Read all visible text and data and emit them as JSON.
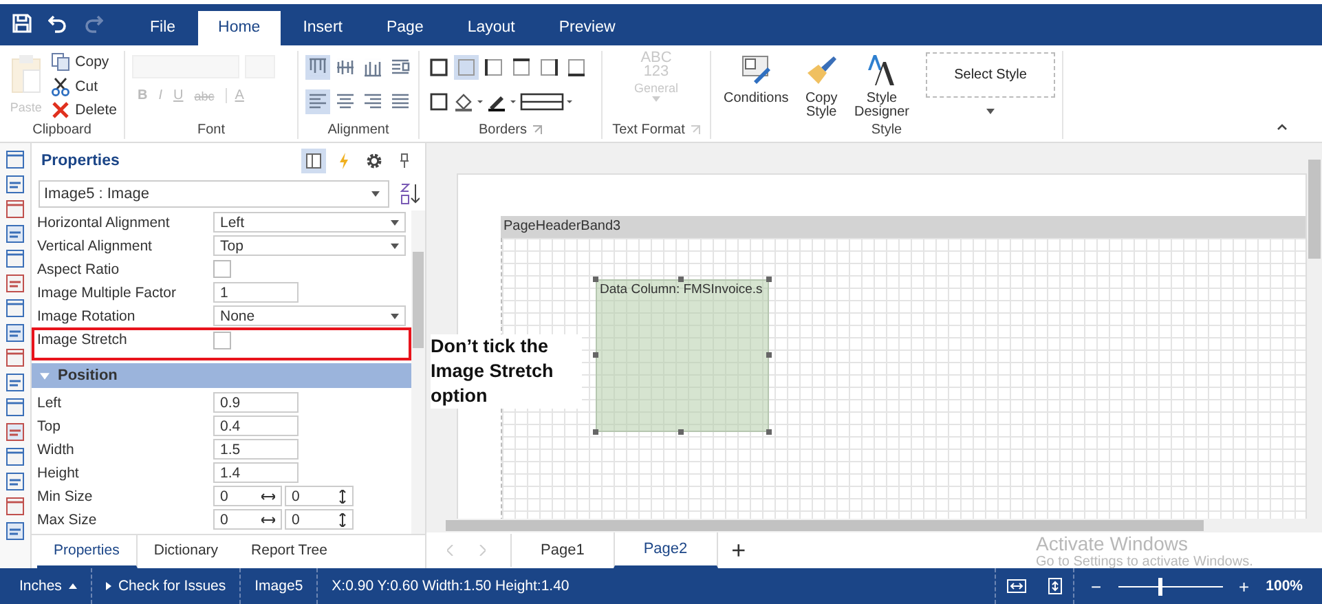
{
  "toolbar": [
    {
      "kind": "save",
      "disabled": false
    },
    {
      "kind": "undo",
      "disabled": false
    },
    {
      "kind": "redo",
      "disabled": true
    }
  ],
  "menu_tabs": [
    {
      "label": "File",
      "selected": false
    },
    {
      "label": "Home",
      "selected": true
    },
    {
      "label": "Insert",
      "selected": false
    },
    {
      "label": "Page",
      "selected": false
    },
    {
      "label": "Layout",
      "selected": false
    },
    {
      "label": "Preview",
      "selected": false
    }
  ],
  "clipboard": {
    "label": "Clipboard",
    "paste": {
      "label": "Paste",
      "disabled": true
    },
    "items": [
      {
        "kind": "copy",
        "label": "Copy"
      },
      {
        "kind": "cut",
        "label": "Cut"
      },
      {
        "kind": "delete",
        "label": "Delete"
      }
    ]
  },
  "font": {
    "label": "Font",
    "disabled": true,
    "styles": [
      "B",
      "I",
      "U",
      "abc",
      "A"
    ]
  },
  "alignment": {
    "label": "Alignment",
    "rows": [
      [
        {
          "kind": "top",
          "selected": true
        },
        {
          "kind": "middle",
          "selected": false
        },
        {
          "kind": "bottom",
          "selected": false
        },
        {
          "kind": "wrap",
          "selected": false
        }
      ],
      [
        {
          "kind": "left",
          "selected": true
        },
        {
          "kind": "center",
          "selected": false
        },
        {
          "kind": "right",
          "selected": false
        },
        {
          "kind": "justify",
          "selected": false
        }
      ]
    ]
  },
  "borders": {
    "label": "Borders",
    "sides": [
      {
        "kind": "all",
        "selected": false
      },
      {
        "kind": "none",
        "selected": true
      },
      {
        "kind": "left",
        "selected": false
      },
      {
        "kind": "top",
        "selected": false
      },
      {
        "kind": "right",
        "selected": false
      },
      {
        "kind": "bottom",
        "selected": false
      }
    ],
    "tools": [
      {
        "kind": "outline"
      },
      {
        "kind": "fill"
      },
      {
        "kind": "pen"
      },
      {
        "kind": "line-style"
      }
    ]
  },
  "text_format": {
    "label": "Text Format",
    "disabled": true,
    "sample": [
      "ABC",
      "123"
    ],
    "format": "General"
  },
  "style": {
    "label": "Style",
    "buttons": [
      {
        "kind": "conditions",
        "label": "Conditions"
      },
      {
        "kind": "copy-style",
        "label": "Copy Style"
      },
      {
        "kind": "designer",
        "label": "Style Designer"
      }
    ],
    "select_style": "Select Style"
  },
  "properties": {
    "title": "Properties",
    "tools": [
      {
        "kind": "grid",
        "selected": true
      },
      {
        "kind": "events",
        "selected": false
      },
      {
        "kind": "settings",
        "selected": false
      },
      {
        "kind": "pin",
        "selected": false
      }
    ],
    "component": "Image5 : Image",
    "rows": [
      {
        "kind": "select",
        "label": "Horizontal Alignment",
        "value": "Left"
      },
      {
        "kind": "select",
        "label": "Vertical Alignment",
        "value": "Top"
      },
      {
        "kind": "checkbox",
        "label": "Aspect Ratio",
        "checked": false
      },
      {
        "kind": "input",
        "label": "Image Multiple Factor",
        "value": "1"
      },
      {
        "kind": "select",
        "label": "Image Rotation",
        "value": "None"
      },
      {
        "kind": "checkbox",
        "label": "Image Stretch",
        "checked": false,
        "highlighted": true
      },
      {
        "kind": "section",
        "label": "Position",
        "expanded": true
      },
      {
        "kind": "input",
        "label": "Left",
        "value": "0.9"
      },
      {
        "kind": "input",
        "label": "Top",
        "value": "0.4"
      },
      {
        "kind": "input",
        "label": "Width",
        "value": "1.5"
      },
      {
        "kind": "input",
        "label": "Height",
        "value": "1.4"
      },
      {
        "kind": "size",
        "label": "Min Size",
        "values": [
          "0",
          "0"
        ]
      },
      {
        "kind": "size",
        "label": "Max Size",
        "values": [
          "0",
          "0"
        ]
      }
    ],
    "tabs": [
      {
        "label": "Properties",
        "selected": true
      },
      {
        "label": "Dictionary",
        "selected": false
      },
      {
        "label": "Report Tree",
        "selected": false
      }
    ]
  },
  "designer": {
    "band": "PageHeaderBand3",
    "component": {
      "label": "Data Column: FMSInvoice.s",
      "selected": true
    },
    "note": "Don’t tick the Image Stretch option",
    "page_tabs": [
      {
        "label": "Page1",
        "selected": false
      },
      {
        "label": "Page2",
        "selected": true
      }
    ],
    "add_page": "+"
  },
  "watermark": [
    "Activate Windows",
    "Go to Settings to activate Windows."
  ],
  "status_bar": {
    "units": "Inches",
    "check": "Check for Issues",
    "selection": "Image5",
    "geometry": "X:0.90 Y:0.60 Width:1.50 Height:1.40",
    "zoom_out": "−",
    "zoom_in": "+",
    "zoom": {
      "level": 0.4
    },
    "zoom_text": "100%"
  }
}
